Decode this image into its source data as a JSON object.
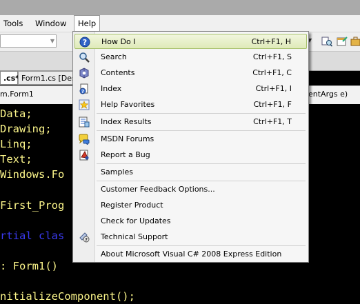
{
  "menubar": {
    "items": [
      "Tools",
      "Window",
      "Help"
    ]
  },
  "tabs": {
    "active": ".cs*",
    "second": "Form1.cs [Des"
  },
  "navbar": {
    "left": "m.Form1",
    "right": "entArgs e)"
  },
  "code_lines": [
    "Data;",
    "Drawing;",
    "Linq;",
    "Text;",
    "Windows.Fo",
    "First_Prog",
    "rtial clas",
    ": Form1()",
    "nitializeComponent();"
  ],
  "help_menu": {
    "items": [
      {
        "label": "How Do I",
        "shortcut": "Ctrl+F1, H",
        "icon": "help-question-icon"
      },
      {
        "label": "Search",
        "shortcut": "Ctrl+F1, S",
        "icon": "search-icon"
      },
      {
        "label": "Contents",
        "shortcut": "Ctrl+F1, C",
        "icon": "contents-book-icon"
      },
      {
        "label": "Index",
        "shortcut": "Ctrl+F1, I",
        "icon": "index-icon"
      },
      {
        "label": "Help Favorites",
        "shortcut": "Ctrl+F1, F",
        "icon": "favorites-star-icon"
      },
      {
        "label": "Index Results",
        "shortcut": "Ctrl+F1, T",
        "icon": "index-results-icon"
      },
      {
        "label": "MSDN Forums",
        "shortcut": "",
        "icon": "forums-icon"
      },
      {
        "label": "Report a Bug",
        "shortcut": "",
        "icon": "bug-report-icon"
      },
      {
        "label": "Samples",
        "shortcut": "",
        "icon": ""
      },
      {
        "label": "Customer Feedback Options...",
        "shortcut": "",
        "icon": ""
      },
      {
        "label": "Register Product",
        "shortcut": "",
        "icon": ""
      },
      {
        "label": "Check for Updates",
        "shortcut": "",
        "icon": ""
      },
      {
        "label": "Technical Support",
        "shortcut": "",
        "icon": "technical-support-icon"
      },
      {
        "label": "About Microsoft Visual C# 2008 Express Edition",
        "shortcut": "",
        "icon": ""
      }
    ]
  },
  "colors": {
    "editor_background": "#000000",
    "code_yellow": "#fbf58a",
    "code_keyword_blue": "#3a3af0",
    "menu_highlight": "#dfeab8"
  }
}
